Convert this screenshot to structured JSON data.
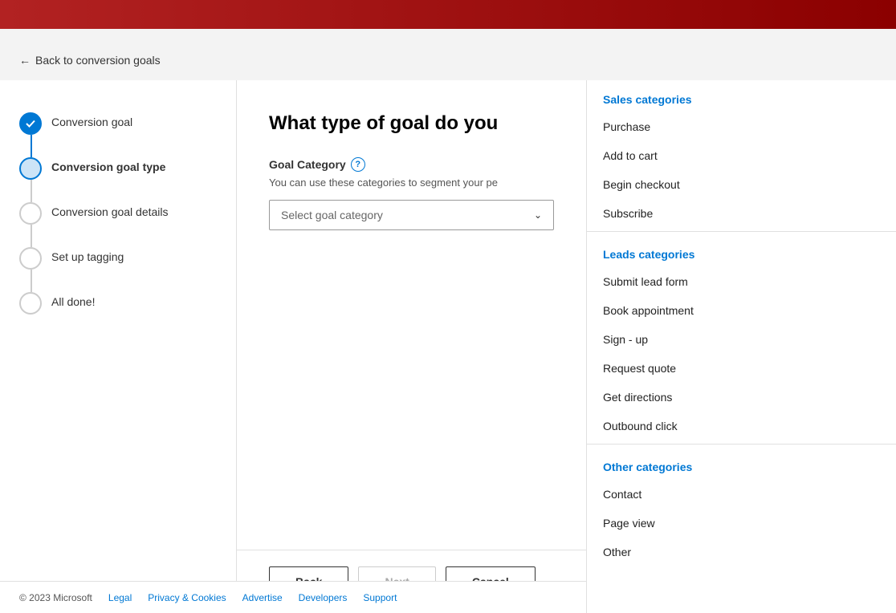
{
  "topbar": {
    "color": "#8b1a1a"
  },
  "back_nav": {
    "arrow": "←",
    "label": "Back to conversion goals"
  },
  "steps": [
    {
      "id": "conversion-goal",
      "label": "Conversion goal",
      "state": "completed"
    },
    {
      "id": "conversion-goal-type",
      "label": "Conversion goal type",
      "state": "active"
    },
    {
      "id": "conversion-goal-details",
      "label": "Conversion goal details",
      "state": "inactive"
    },
    {
      "id": "set-up-tagging",
      "label": "Set up tagging",
      "state": "inactive"
    },
    {
      "id": "all-done",
      "label": "All done!",
      "state": "inactive"
    }
  ],
  "form": {
    "title": "What type of goal do you",
    "goal_category_label": "Goal Category",
    "help_icon": "?",
    "description": "You can use these categories to segment your pe",
    "select_placeholder": "Select goal category"
  },
  "actions": {
    "back_label": "Back",
    "next_label": "Next",
    "cancel_label": "Cancel"
  },
  "dropdown": {
    "sections": [
      {
        "id": "sales",
        "header": "Sales categories",
        "items": [
          "Purchase",
          "Add to cart",
          "Begin checkout",
          "Subscribe"
        ]
      },
      {
        "id": "leads",
        "header": "Leads categories",
        "items": [
          "Submit lead form",
          "Book appointment",
          "Sign - up",
          "Request quote",
          "Get directions",
          "Outbound click"
        ]
      },
      {
        "id": "other",
        "header": "Other categories",
        "items": [
          "Contact",
          "Page view",
          "Other"
        ]
      }
    ]
  },
  "footer": {
    "copyright": "© 2023 Microsoft",
    "links": [
      {
        "label": "Legal"
      },
      {
        "label": "Privacy & Cookies"
      },
      {
        "label": "Advertise"
      },
      {
        "label": "Developers"
      },
      {
        "label": "Support"
      }
    ]
  }
}
